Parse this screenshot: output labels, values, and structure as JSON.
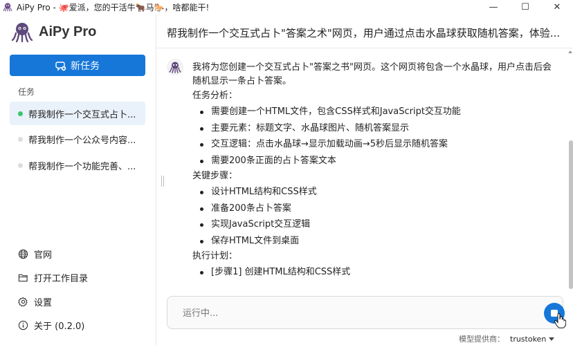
{
  "window": {
    "title": "AiPy Pro - 🐙爱派，您的干活牛🐂马🐎，啥都能干!",
    "minimize": "—",
    "maximize": "☐",
    "close": "✕"
  },
  "sidebar": {
    "brand": "AiPy Pro",
    "new_task": "新任务",
    "section_label": "任务",
    "tasks": [
      {
        "label": "帮我制作一个交互式占卜..."
      },
      {
        "label": "帮我制作一个公众号内容..."
      },
      {
        "label": "帮我制作一个功能完善、..."
      }
    ],
    "nav": [
      {
        "label": "官网",
        "icon": "globe-icon"
      },
      {
        "label": "打开工作目录",
        "icon": "folder-icon"
      },
      {
        "label": "设置",
        "icon": "gear-icon"
      },
      {
        "label": "关于 (0.2.0)",
        "icon": "info-icon"
      }
    ]
  },
  "main": {
    "title": "帮我制作一个交互式占卜\"答案之术\"网页，用户通过点击水晶球获取随机答案，体验...",
    "message": {
      "intro": "我将为您创建一个交互式占卜\"答案之书\"网页。这个网页将包含一个水晶球，用户点击后会随机显示一条占卜答案。",
      "analysis_heading": "任务分析：",
      "analysis": [
        "需要创建一个HTML文件，包含CSS样式和JavaScript交互功能",
        "主要元素：标题文字、水晶球图片、随机答案显示",
        "交互逻辑：点击水晶球→显示加载动画→5秒后显示随机答案",
        "需要200条正面的占卜答案文本"
      ],
      "steps_heading": "关键步骤：",
      "steps": [
        "设计HTML结构和CSS样式",
        "准备200条占卜答案",
        "实现JavaScript交互逻辑",
        "保存HTML文件到桌面"
      ],
      "plan_heading": "执行计划：",
      "plan": [
        "[步骤1] 创建HTML结构和CSS样式"
      ]
    },
    "input": {
      "placeholder": "运行中..."
    },
    "provider": {
      "label": "模型提供商：",
      "value": "trustoken"
    }
  },
  "colors": {
    "accent": "#1677d9",
    "active_task_bg": "#e9f1fa",
    "status_dot": "#3cc46b"
  }
}
